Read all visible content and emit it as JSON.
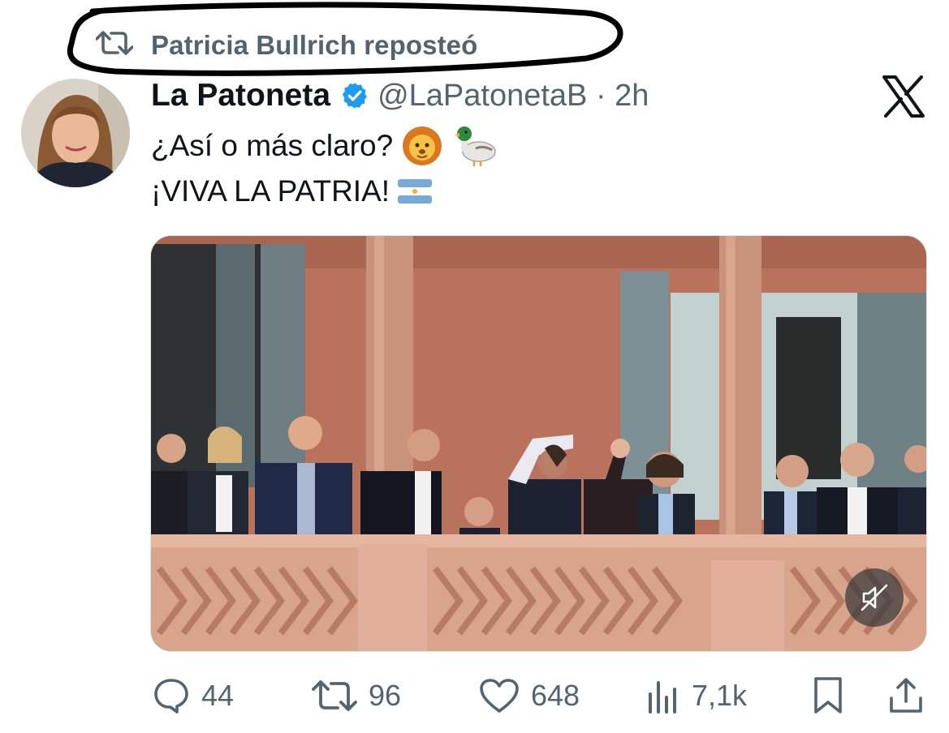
{
  "repost": {
    "label": "Patricia Bullrich reposteó",
    "icon": "repost-icon"
  },
  "tweet": {
    "display_name": "La Patoneta",
    "verified": true,
    "handle_time": "@LaPatonetaB · 2h",
    "line1": "¿Así o más claro?",
    "line2": "¡VIVA LA PATRIA!",
    "line1_emojis": [
      "lion-face-emoji",
      "duck-emoji"
    ],
    "line2_emojis": [
      "argentina-flag-emoji"
    ]
  },
  "brand": {
    "logo": "x-logo",
    "verified_color": "#1d9bf0"
  },
  "media": {
    "type": "video",
    "muted": true,
    "mute_icon": "speaker-muted-icon"
  },
  "actions": {
    "replies": "44",
    "reposts": "96",
    "likes": "648",
    "views": "7,1k"
  },
  "colors": {
    "text": "#0f1419",
    "muted": "#536471"
  }
}
